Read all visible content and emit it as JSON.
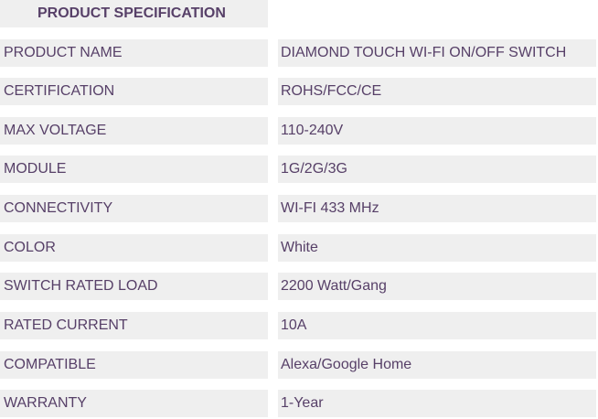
{
  "title": "PRODUCT SPECIFICATION",
  "rows": [
    {
      "label": "PRODUCT NAME",
      "value": "DIAMOND TOUCH WI-FI ON/OFF SWITCH"
    },
    {
      "label": "CERTIFICATION",
      "value": "ROHS/FCC/CE"
    },
    {
      "label": "MAX VOLTAGE",
      "value": "110-240V"
    },
    {
      "label": "MODULE",
      "value": "1G/2G/3G"
    },
    {
      "label": "CONNECTIVITY",
      "value": "WI-FI 433 MHz"
    },
    {
      "label": "COLOR",
      "value": "White"
    },
    {
      "label": "SWITCH RATED LOAD",
      "value": "2200 Watt/Gang"
    },
    {
      "label": "RATED CURRENT",
      "value": "10A"
    },
    {
      "label": "COMPATIBLE",
      "value": "Alexa/Google Home"
    },
    {
      "label": "WARRANTY",
      "value": "1-Year"
    }
  ],
  "colors": {
    "text": "#574068",
    "cell_background": "#efefef"
  }
}
